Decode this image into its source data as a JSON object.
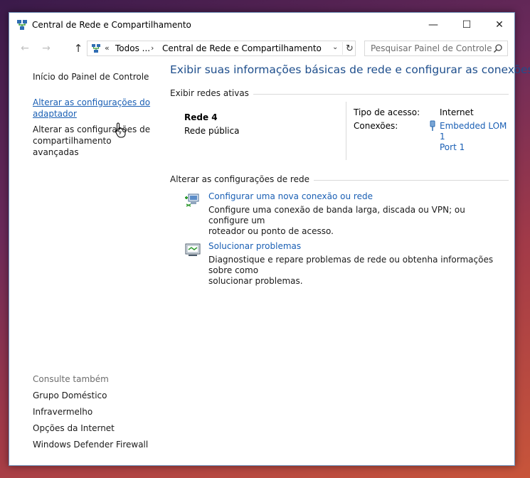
{
  "window": {
    "title": "Central de Rede e Compartilhamento",
    "controls": {
      "minimize": "—",
      "maximize": "☐",
      "close": "✕"
    }
  },
  "nav": {
    "back": "←",
    "forward": "→",
    "up": "↑",
    "breadcrumb_chevron": "«",
    "crumb1": "Todos ...",
    "crumb_sep": "›",
    "crumb2": "Central de Rede e Compartilhamento",
    "dropdown": "⌄",
    "refresh": "↻",
    "search_placeholder": "Pesquisar Painel de Controle"
  },
  "sidebar": {
    "home": "Início do Painel de Controle",
    "adapter_line1": "Alterar as configurações do",
    "adapter_line2": "adaptador",
    "share_line1": "Alterar as configurações de",
    "share_line2": "compartilhamento avançadas",
    "see_also": "Consulte também",
    "see_items": [
      "Grupo Doméstico",
      "Infravermelho",
      "Opções da Internet",
      "Windows Defender Firewall"
    ]
  },
  "main": {
    "title": "Exibir suas informações básicas de rede e configurar as conexões",
    "active_networks_label": "Exibir redes ativas",
    "network_name": "Rede  4",
    "network_type": "Rede pública",
    "access_type_label": "Tipo de acesso:",
    "access_type_value": "Internet",
    "connections_label": "Conexões:",
    "connection_line1": "Embedded LOM 1",
    "connection_line2": "Port 1",
    "change_settings_label": "Alterar as configurações de rede",
    "tasks": [
      {
        "link": "Configurar uma nova conexão ou rede",
        "desc_line1": "Configure uma conexão de banda larga, discada ou VPN; ou configure um",
        "desc_line2": "roteador ou ponto de acesso."
      },
      {
        "link": "Solucionar problemas",
        "desc_line1": "Diagnostique e repare problemas de rede ou obtenha informações sobre como",
        "desc_line2": "solucionar problemas."
      }
    ]
  },
  "colors": {
    "link": "#1a5fb4",
    "title": "#1e4e8c",
    "muted": "#6d6d6d"
  }
}
